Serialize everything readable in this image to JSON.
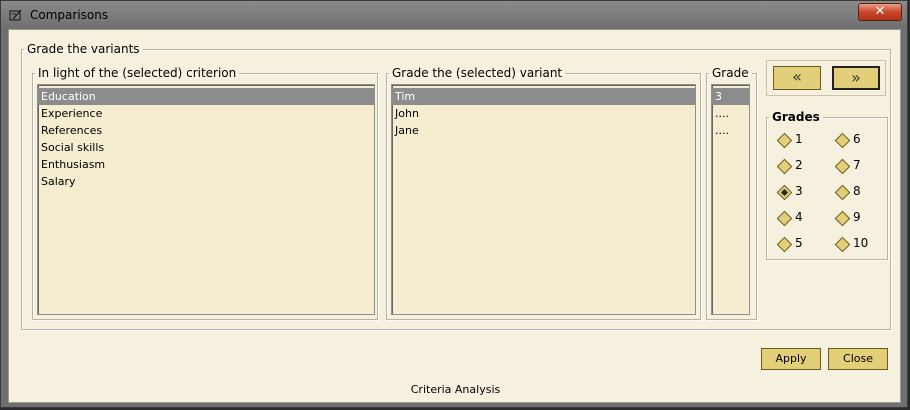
{
  "window": {
    "title": "Comparisons",
    "close_label": "✕"
  },
  "group": {
    "legend": "Grade the variants"
  },
  "criteria": {
    "legend": "In light of the (selected) criterion",
    "items": [
      "Education",
      "Experience",
      "References",
      "Social skills",
      "Enthusiasm",
      "Salary"
    ],
    "selected_index": 0
  },
  "variants": {
    "legend": "Grade the (selected) variant",
    "items": [
      "Tim",
      "John",
      "Jane"
    ],
    "selected_index": 0
  },
  "grades_list": {
    "legend": "Grade",
    "items": [
      "3",
      "....",
      "...."
    ]
  },
  "nav": {
    "prev_label": "«",
    "next_label": "»"
  },
  "grades": {
    "legend": "Grades",
    "options": [
      "1",
      "2",
      "3",
      "4",
      "5",
      "6",
      "7",
      "8",
      "9",
      "10"
    ],
    "selected": "3"
  },
  "buttons": {
    "apply": "Apply",
    "close": "Close"
  },
  "status": "Criteria Analysis",
  "colors": {
    "accent": "#e3cf79",
    "panel": "#f6f1de",
    "selection": "#8c8c8c"
  }
}
